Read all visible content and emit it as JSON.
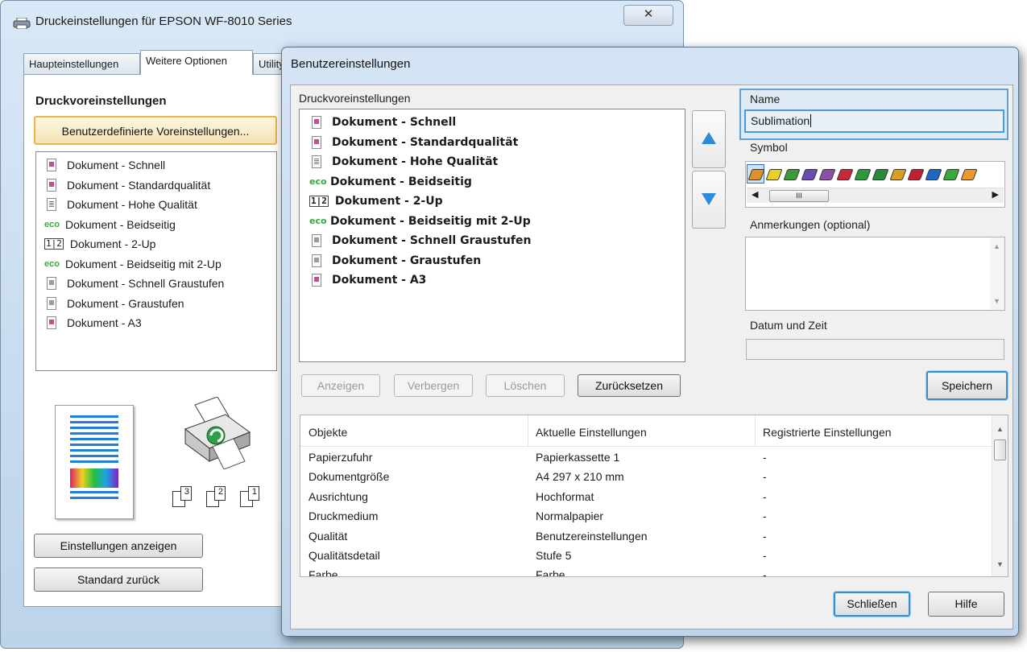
{
  "bg_window": {
    "title": "Druckeinstellungen für EPSON WF-8010 Series",
    "close_glyph": "✕",
    "tabs": [
      "Haupteinstellungen",
      "Weitere Optionen",
      "Utility"
    ],
    "presets_heading": "Druckvoreinstellungen",
    "custom_presets_button": "Benutzerdefinierte Voreinstellungen...",
    "presets": [
      {
        "icon": "doc-icon",
        "label": "Dokument - Schnell"
      },
      {
        "icon": "doc-icon",
        "label": "Dokument - Standardqualität"
      },
      {
        "icon": "doc-hq-icon",
        "label": "Dokument - Hohe Qualität"
      },
      {
        "icon": "eco-icon",
        "label": "Dokument - Beidseitig"
      },
      {
        "icon": "two-up-icon",
        "label": "Dokument - 2-Up"
      },
      {
        "icon": "eco-icon",
        "label": "Dokument - Beidseitig mit 2-Up"
      },
      {
        "icon": "doc-gray-icon",
        "label": "Dokument - Schnell Graustufen"
      },
      {
        "icon": "doc-gray-icon",
        "label": "Dokument - Graustufen"
      },
      {
        "icon": "doc-icon",
        "label": "Dokument - A3"
      }
    ],
    "page_order_labels": [
      "3",
      "2",
      "1"
    ],
    "show_settings_button": "Einstellungen anzeigen",
    "reset_default_button": "Standard zurück"
  },
  "dialog": {
    "title": "Benutzereinstellungen",
    "presets_label": "Druckvoreinstellungen",
    "presets": [
      {
        "icon": "doc-icon",
        "label": "Dokument - Schnell"
      },
      {
        "icon": "doc-icon",
        "label": "Dokument - Standardqualität"
      },
      {
        "icon": "doc-hq-icon",
        "label": "Dokument - Hohe Qualität"
      },
      {
        "icon": "eco-icon",
        "label": "Dokument - Beidseitig"
      },
      {
        "icon": "two-up-icon",
        "label": "Dokument - 2-Up"
      },
      {
        "icon": "eco-icon",
        "label": "Dokument - Beidseitig mit 2-Up"
      },
      {
        "icon": "doc-gray-icon",
        "label": "Dokument - Schnell Graustufen"
      },
      {
        "icon": "doc-gray-icon",
        "label": "Dokument - Graustufen"
      },
      {
        "icon": "doc-icon",
        "label": "Dokument - A3"
      }
    ],
    "buttons": {
      "show": "Anzeigen",
      "hide": "Verbergen",
      "delete": "Löschen",
      "reset": "Zurücksetzen",
      "save": "Speichern",
      "close": "Schließen",
      "help": "Hilfe"
    },
    "name_label": "Name",
    "name_value": "Sublimation",
    "symbol_label": "Symbol",
    "symbol_colors": [
      "#e0902a",
      "#e8d22a",
      "#3c9a3a",
      "#6a4bb0",
      "#8c4fa6",
      "#c8283a",
      "#2a9a3a",
      "#2a8a3a",
      "#d8a020",
      "#c02030",
      "#1e66c8",
      "#3aa83a",
      "#e89a2a"
    ],
    "scroll_thumb_label": "III",
    "notes_label": "Anmerkungen (optional)",
    "notes_value": "",
    "datetime_label": "Datum und Zeit",
    "datetime_value": "",
    "table": {
      "headers": [
        "Objekte",
        "Aktuelle Einstellungen",
        "Registrierte Einstellungen"
      ],
      "rows": [
        [
          "Papierzufuhr",
          "Papierkassette 1",
          "-"
        ],
        [
          "Dokumentgröße",
          "A4 297 x 210 mm",
          "-"
        ],
        [
          "Ausrichtung",
          "Hochformat",
          "-"
        ],
        [
          "Druckmedium",
          "Normalpapier",
          "-"
        ],
        [
          "Qualität",
          "Benutzereinstellungen",
          "-"
        ],
        [
          "Qualitätsdetail",
          "Stufe 5",
          "-"
        ],
        [
          "Farbe",
          "Farbe",
          "-"
        ]
      ]
    }
  }
}
